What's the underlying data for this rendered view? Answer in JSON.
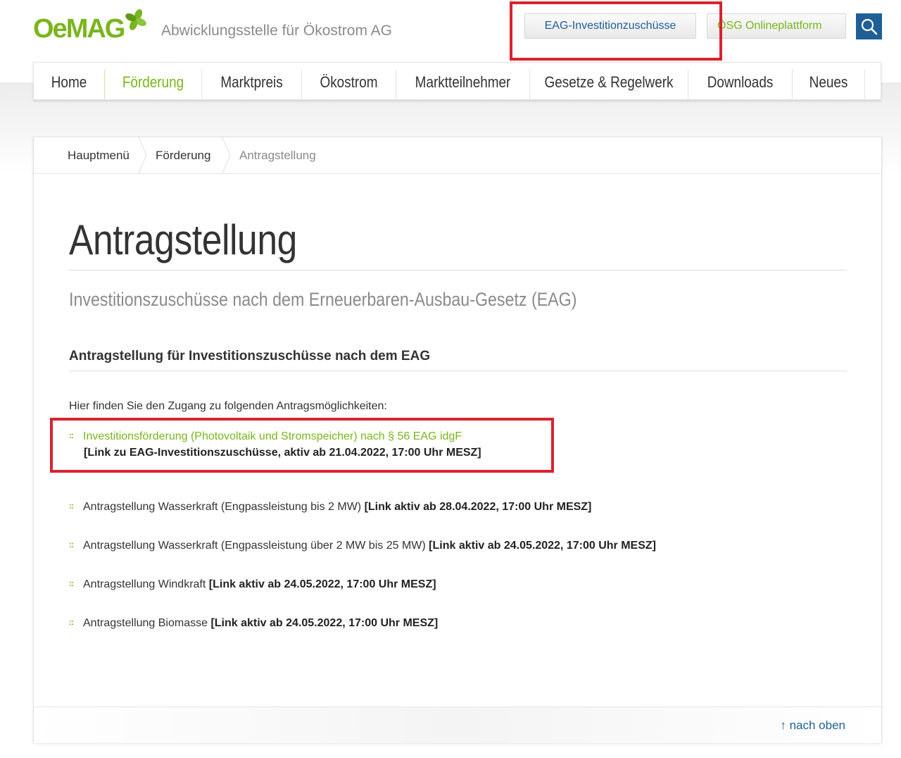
{
  "header": {
    "logo_text": "OeMAG",
    "tagline": "Abwicklungsstelle für Ökostrom AG",
    "btn_eag": "EAG-Investitionzuschüsse",
    "btn_osg": "ÖSG Onlineplattform",
    "brand_green": "#7ab51d",
    "brand_blue": "#1f5f96",
    "highlight_red": "#d9232f"
  },
  "nav": {
    "items": [
      "Home",
      "Förderung",
      "Marktpreis",
      "Ökostrom",
      "Marktteilnehmer",
      "Gesetze & Regelwerk",
      "Downloads",
      "Neues"
    ],
    "active": "Förderung"
  },
  "breadcrumb": [
    "Hauptmenü",
    "Förderung",
    "Antragstellung"
  ],
  "main": {
    "title": "Antragstellung",
    "subtitle": "Investitionszuschüsse nach dem Erneuerbaren-Ausbau-Gesetz (EAG)",
    "section_heading": "Antragstellung für Investitionszuschüsse nach dem EAG",
    "intro": "Hier finden Sie den Zugang zu folgenden Antragsmöglichkeiten:",
    "items": [
      {
        "text": "Investitionsförderung (Photovoltaik und Stromspeicher) nach § 56 EAG idgF",
        "bold": "[Link zu EAG-Investitionszuschüsse, aktiv ab 21.04.2022, 17:00 Uhr MESZ]"
      },
      {
        "text": "Antragstellung Wasserkraft (Engpassleistung bis 2 MW)",
        "bold": "[Link aktiv ab 28.04.2022, 17:00 Uhr MESZ]"
      },
      {
        "text": "Antragstellung Wasserkraft (Engpassleistung über 2 MW bis 25 MW)",
        "bold": "[Link aktiv ab 24.05.2022, 17:00 Uhr MESZ]"
      },
      {
        "text": "Antragstellung Windkraft",
        "bold": "[Link aktiv ab 24.05.2022, 17:00 Uhr MESZ]"
      },
      {
        "text": "Antragstellung Biomasse",
        "bold": "[Link aktiv ab 24.05.2022, 17:00 Uhr MESZ]"
      }
    ]
  },
  "footer": {
    "to_top": "nach oben",
    "to_top_icon": "arrow-up-icon"
  },
  "icons": {
    "search": "search-icon",
    "bullet": "square-dots-icon",
    "logo": "clover-leaf-icon"
  }
}
